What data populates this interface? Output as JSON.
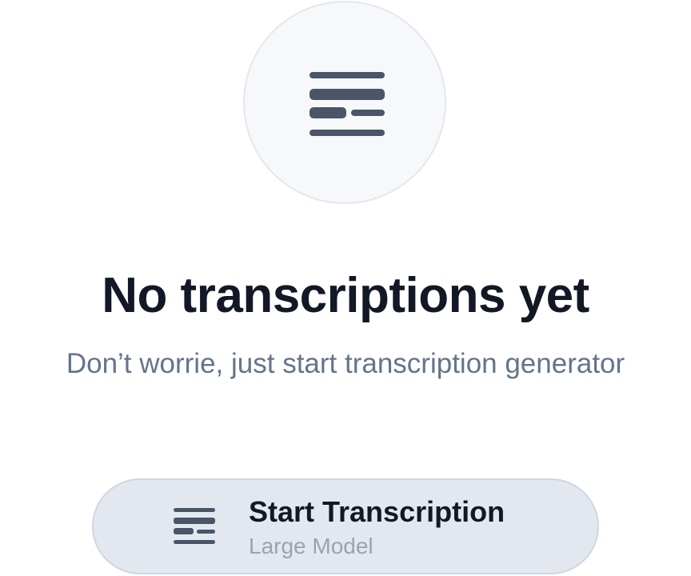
{
  "empty_state": {
    "icon": "transcript-lines-icon",
    "title": "No transcriptions yet",
    "subtitle": "Don’t worrie, just start transcription generator"
  },
  "start_button": {
    "icon": "transcript-lines-icon",
    "label": "Start Transcription",
    "sublabel": "Large Model"
  },
  "colors": {
    "icon": "#4a5568",
    "title": "#121826",
    "subtitle": "#64748b",
    "button_bg": "#e3e8f0"
  }
}
